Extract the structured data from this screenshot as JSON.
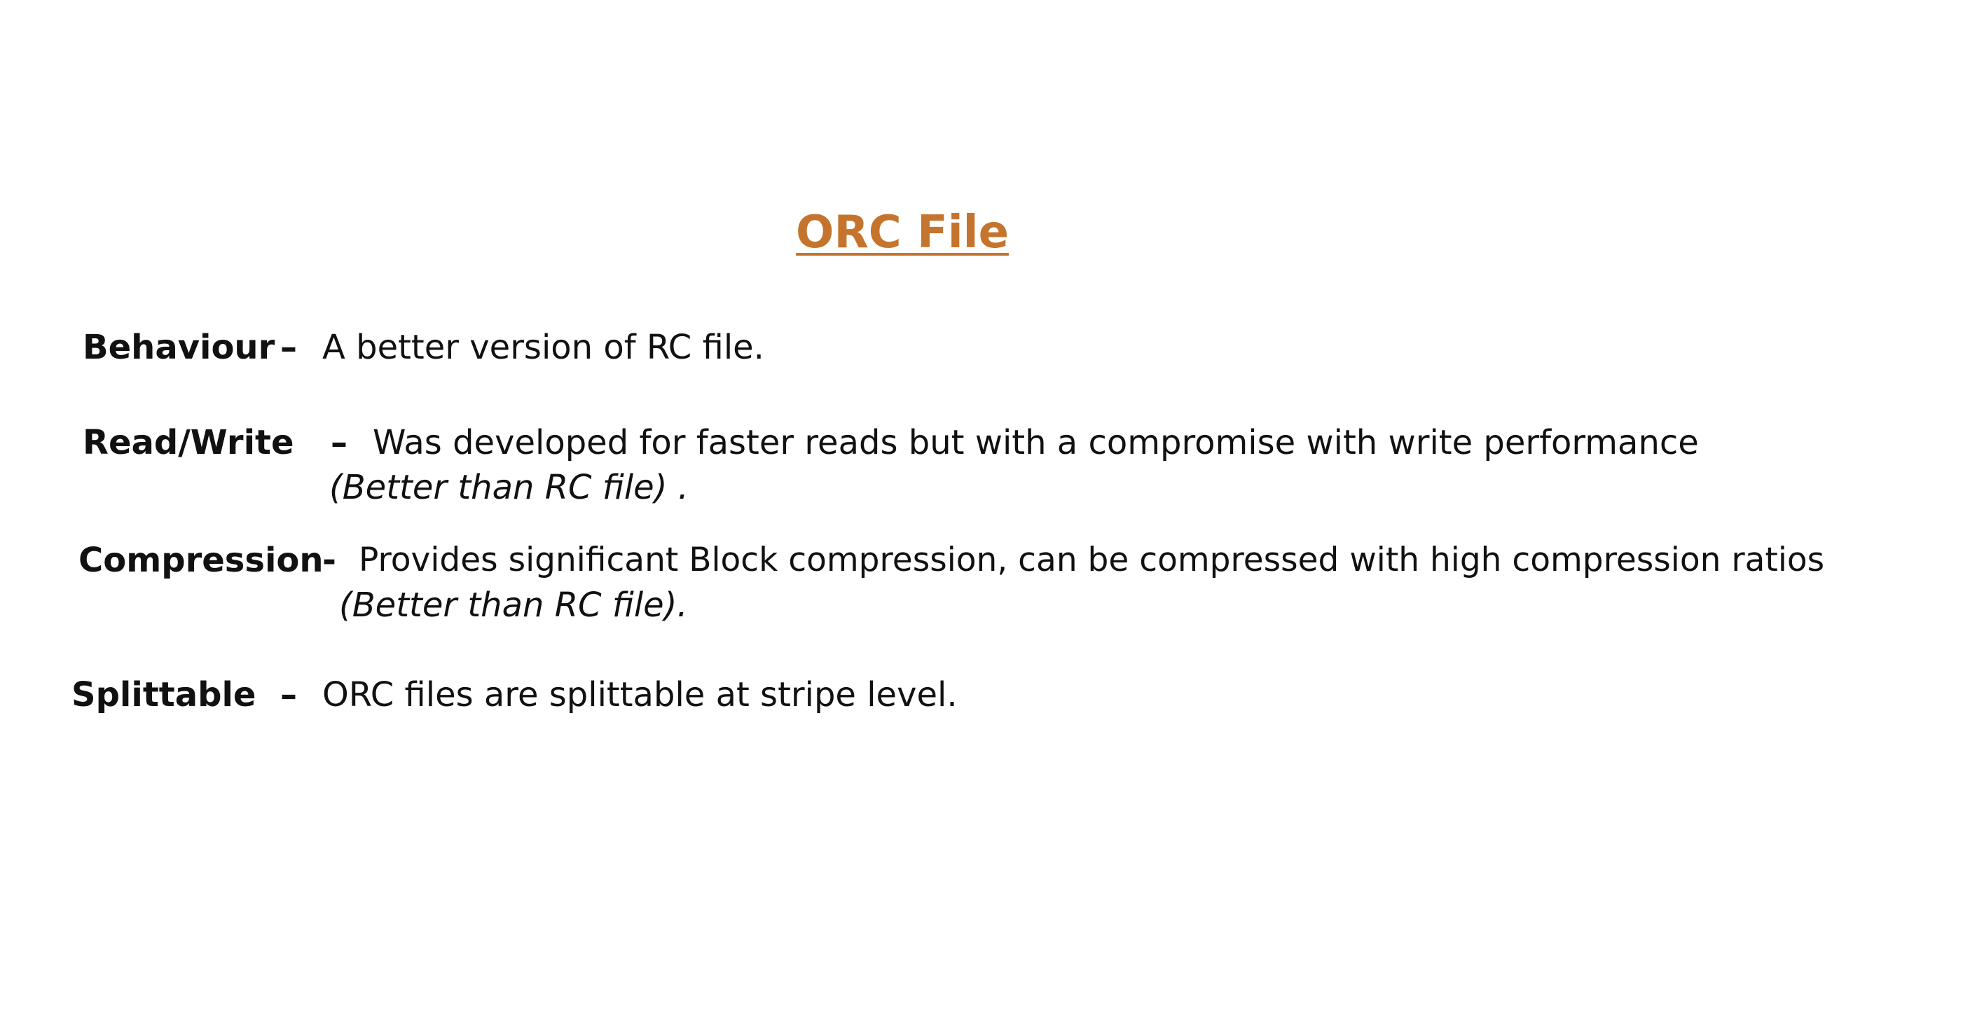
{
  "title": "ORC File",
  "colors": {
    "title": "#c5742d",
    "text": "#111111",
    "background": "#ffffff"
  },
  "rows": [
    {
      "term": "Behaviour",
      "dash": "–",
      "description": "A better version of RC file."
    },
    {
      "term": "Read/Write",
      "dash": "–",
      "description": "Was developed for faster reads but with a compromise  with write performance",
      "note": "(Better than RC file) ."
    },
    {
      "term": "Compression",
      "dash": "-",
      "description": "Provides significant Block compression, can be compressed with high compression ratios",
      "note": "(Better than RC file)."
    },
    {
      "term": "Splittable",
      "dash": "–",
      "description": "ORC files are splittable at stripe level."
    }
  ]
}
